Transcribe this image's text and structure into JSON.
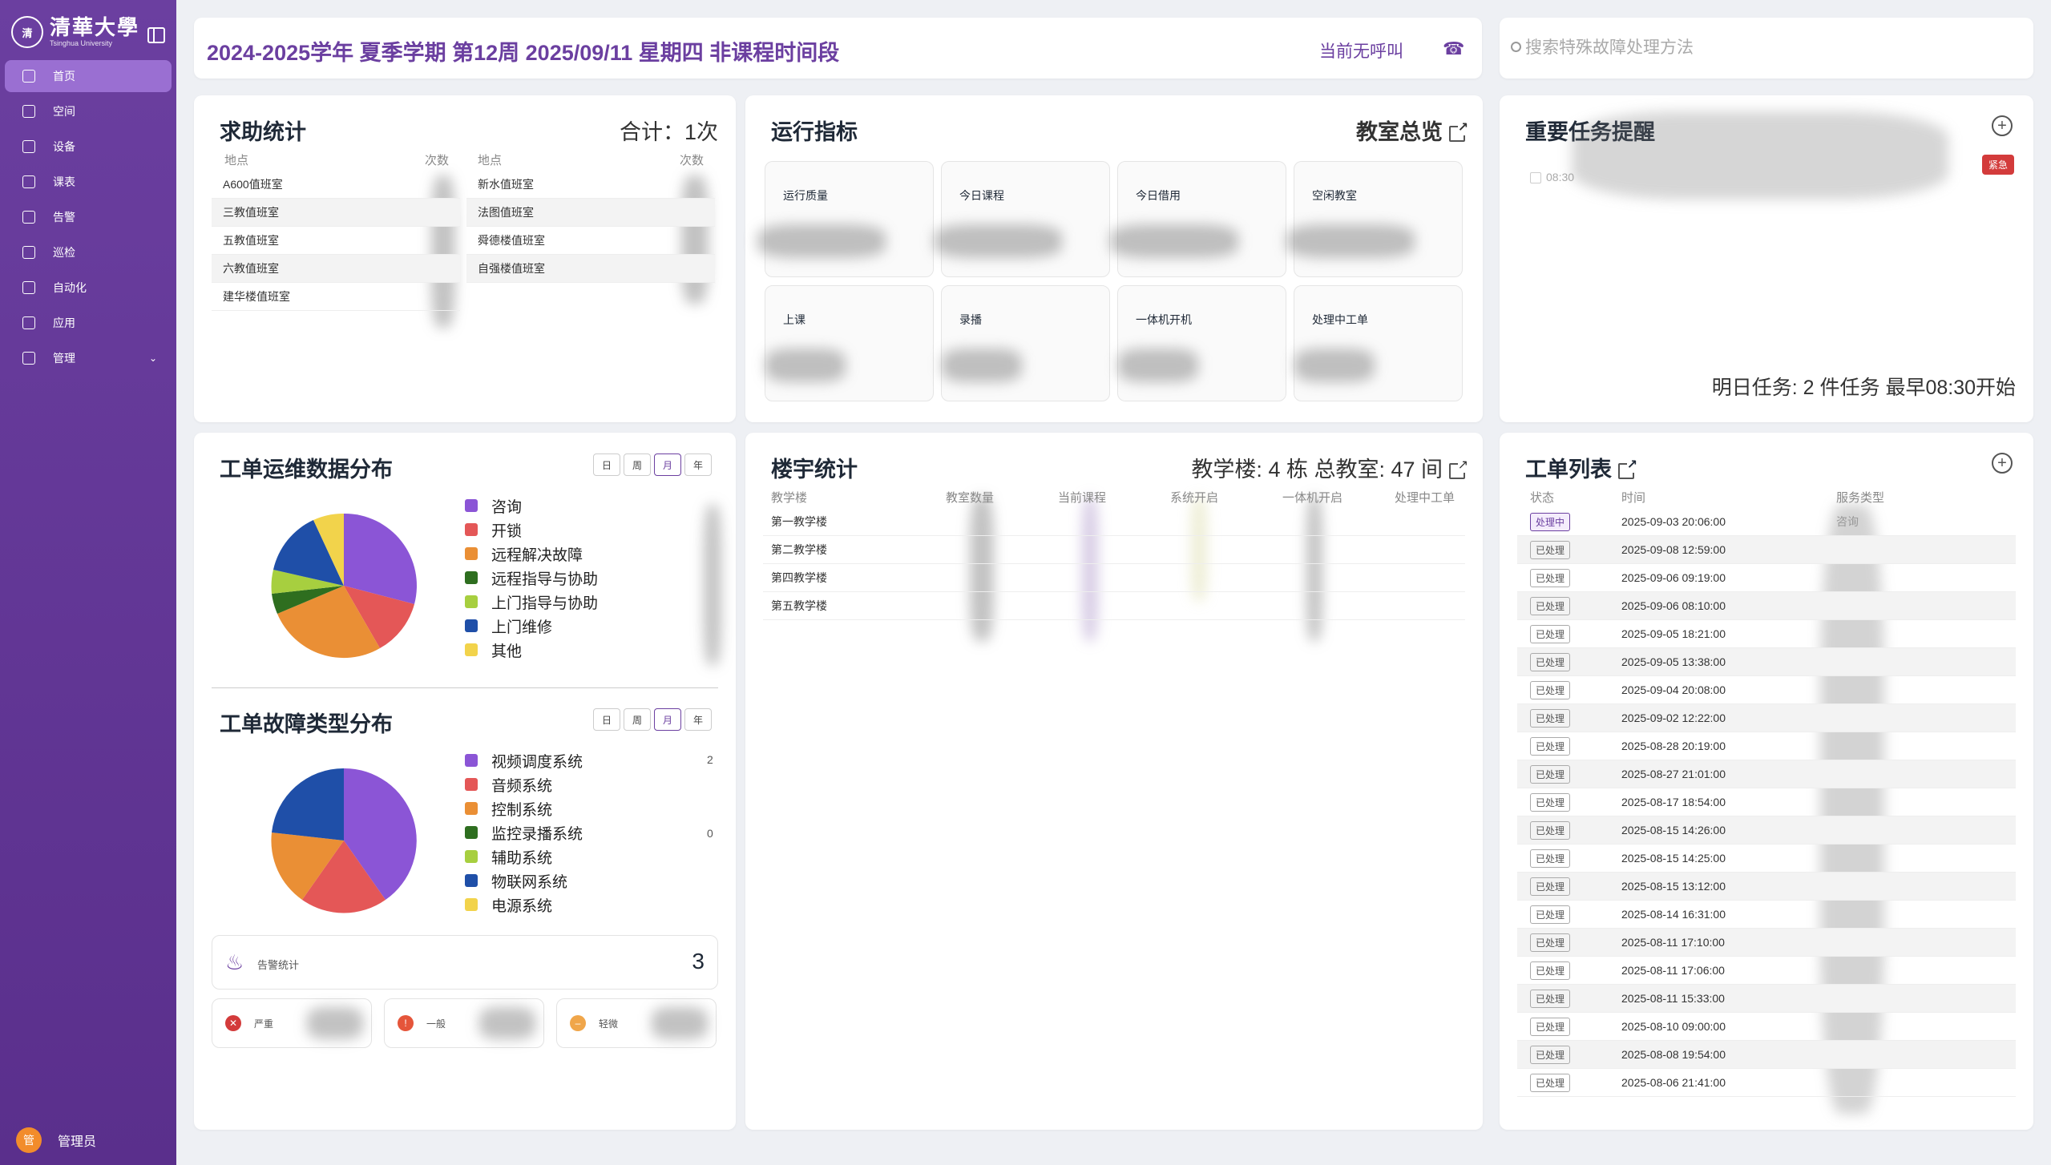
{
  "sidebar": {
    "logo_cn": "清華大學",
    "logo_en": "Tsinghua University",
    "items": [
      {
        "label": "首页",
        "icon": "home-icon",
        "active": true
      },
      {
        "label": "空间",
        "icon": "building-icon"
      },
      {
        "label": "设备",
        "icon": "device-icon"
      },
      {
        "label": "课表",
        "icon": "book-icon"
      },
      {
        "label": "告警",
        "icon": "clipboard-icon"
      },
      {
        "label": "巡检",
        "icon": "checklist-icon"
      },
      {
        "label": "自动化",
        "icon": "clock-icon"
      },
      {
        "label": "应用",
        "icon": "apps-icon"
      },
      {
        "label": "管理",
        "icon": "gear-icon",
        "expand": true
      }
    ],
    "user": {
      "avatar": "管",
      "name": "管理员"
    }
  },
  "header": {
    "term": "2024-2025学年 夏季学期 第12周 2025/09/11 星期四 非课程时间段",
    "call_status": "当前无呼叫"
  },
  "search": {
    "placeholder": "搜索特殊故障处理方法"
  },
  "help_stats": {
    "title": "求助统计",
    "total": "合计：1次",
    "col_place": "地点",
    "col_count": "次数",
    "left_rows": [
      "A600值班室",
      "三教值班室",
      "五教值班室",
      "六教值班室",
      "建华楼值班室"
    ],
    "right_rows": [
      "新水值班室",
      "法图值班室",
      "舜德楼值班室",
      "自强楼值班室"
    ]
  },
  "ops": {
    "title": "运行指标",
    "link": "教室总览",
    "metrics": [
      "运行质量",
      "今日课程",
      "今日借用",
      "空闲教室",
      "上课",
      "录播",
      "一体机开机",
      "处理中工单"
    ]
  },
  "tasks": {
    "title": "重要任务提醒",
    "item_time": "08:30",
    "badge": "紧急",
    "footer": "明日任务: 2 件任务 最早08:30开始"
  },
  "ticket_dist": {
    "title": "工单运维数据分布",
    "periods": [
      "日",
      "周",
      "月",
      "年"
    ],
    "active_period": "月",
    "legend": [
      {
        "label": "咨询",
        "color": "#8b55d6"
      },
      {
        "label": "开锁",
        "color": "#e45757"
      },
      {
        "label": "远程解决故障",
        "color": "#ea8f35"
      },
      {
        "label": "远程指导与协助",
        "color": "#2e6e1f"
      },
      {
        "label": "上门指导与协助",
        "color": "#a7cf3f"
      },
      {
        "label": "上门维修",
        "color": "#1f4fa8"
      },
      {
        "label": "其他",
        "color": "#f2d34b"
      }
    ]
  },
  "fault_dist": {
    "title": "工单故障类型分布",
    "periods": [
      "日",
      "周",
      "月",
      "年"
    ],
    "active_period": "月",
    "legend": [
      {
        "label": "视频调度系统",
        "color": "#8b55d6"
      },
      {
        "label": "音频系统",
        "color": "#e45757"
      },
      {
        "label": "控制系统",
        "color": "#ea8f35"
      },
      {
        "label": "监控录播系统",
        "color": "#2e6e1f"
      },
      {
        "label": "辅助系统",
        "color": "#a7cf3f"
      },
      {
        "label": "物联网系统",
        "color": "#1f4fa8"
      },
      {
        "label": "电源系统",
        "color": "#f2d34b"
      }
    ],
    "visible_counts": [
      "2",
      "0"
    ]
  },
  "alarms": {
    "title": "告警统计",
    "total": "3",
    "levels": [
      {
        "label": "严重",
        "color": "#d33b3b",
        "glyph": "✕"
      },
      {
        "label": "一般",
        "color": "#e5553a",
        "glyph": "!"
      },
      {
        "label": "轻微",
        "color": "#f0a64a",
        "glyph": "–"
      }
    ]
  },
  "buildings": {
    "title": "楼宇统计",
    "summary": "教学楼: 4 栋 总教室: 47 间",
    "headers": [
      "教学楼",
      "教室数量",
      "当前课程",
      "系统开启",
      "一体机开启",
      "处理中工单"
    ],
    "rows": [
      "第一教学楼",
      "第二教学楼",
      "第四教学楼",
      "第五教学楼"
    ]
  },
  "tickets": {
    "title": "工单列表",
    "headers": [
      "状态",
      "时间",
      "服务类型"
    ],
    "rows": [
      {
        "status": "处理中",
        "time": "2025-09-03 20:06:00",
        "type": "咨询"
      },
      {
        "status": "已处理",
        "time": "2025-09-08 12:59:00"
      },
      {
        "status": "已处理",
        "time": "2025-09-06 09:19:00"
      },
      {
        "status": "已处理",
        "time": "2025-09-06 08:10:00"
      },
      {
        "status": "已处理",
        "time": "2025-09-05 18:21:00"
      },
      {
        "status": "已处理",
        "time": "2025-09-05 13:38:00"
      },
      {
        "status": "已处理",
        "time": "2025-09-04 20:08:00"
      },
      {
        "status": "已处理",
        "time": "2025-09-02 12:22:00"
      },
      {
        "status": "已处理",
        "time": "2025-08-28 20:19:00"
      },
      {
        "status": "已处理",
        "time": "2025-08-27 21:01:00"
      },
      {
        "status": "已处理",
        "time": "2025-08-17 18:54:00"
      },
      {
        "status": "已处理",
        "time": "2025-08-15 14:26:00"
      },
      {
        "status": "已处理",
        "time": "2025-08-15 14:25:00"
      },
      {
        "status": "已处理",
        "time": "2025-08-15 13:12:00"
      },
      {
        "status": "已处理",
        "time": "2025-08-14 16:31:00"
      },
      {
        "status": "已处理",
        "time": "2025-08-11 17:10:00"
      },
      {
        "status": "已处理",
        "time": "2025-08-11 17:06:00"
      },
      {
        "status": "已处理",
        "time": "2025-08-11 15:33:00"
      },
      {
        "status": "已处理",
        "time": "2025-08-10 09:00:00"
      },
      {
        "status": "已处理",
        "time": "2025-08-08 19:54:00"
      },
      {
        "status": "已处理",
        "time": "2025-08-06 21:41:00"
      }
    ]
  },
  "colors": {
    "accent": "#6b3fa0",
    "sidebar": "#5a2f8c"
  }
}
